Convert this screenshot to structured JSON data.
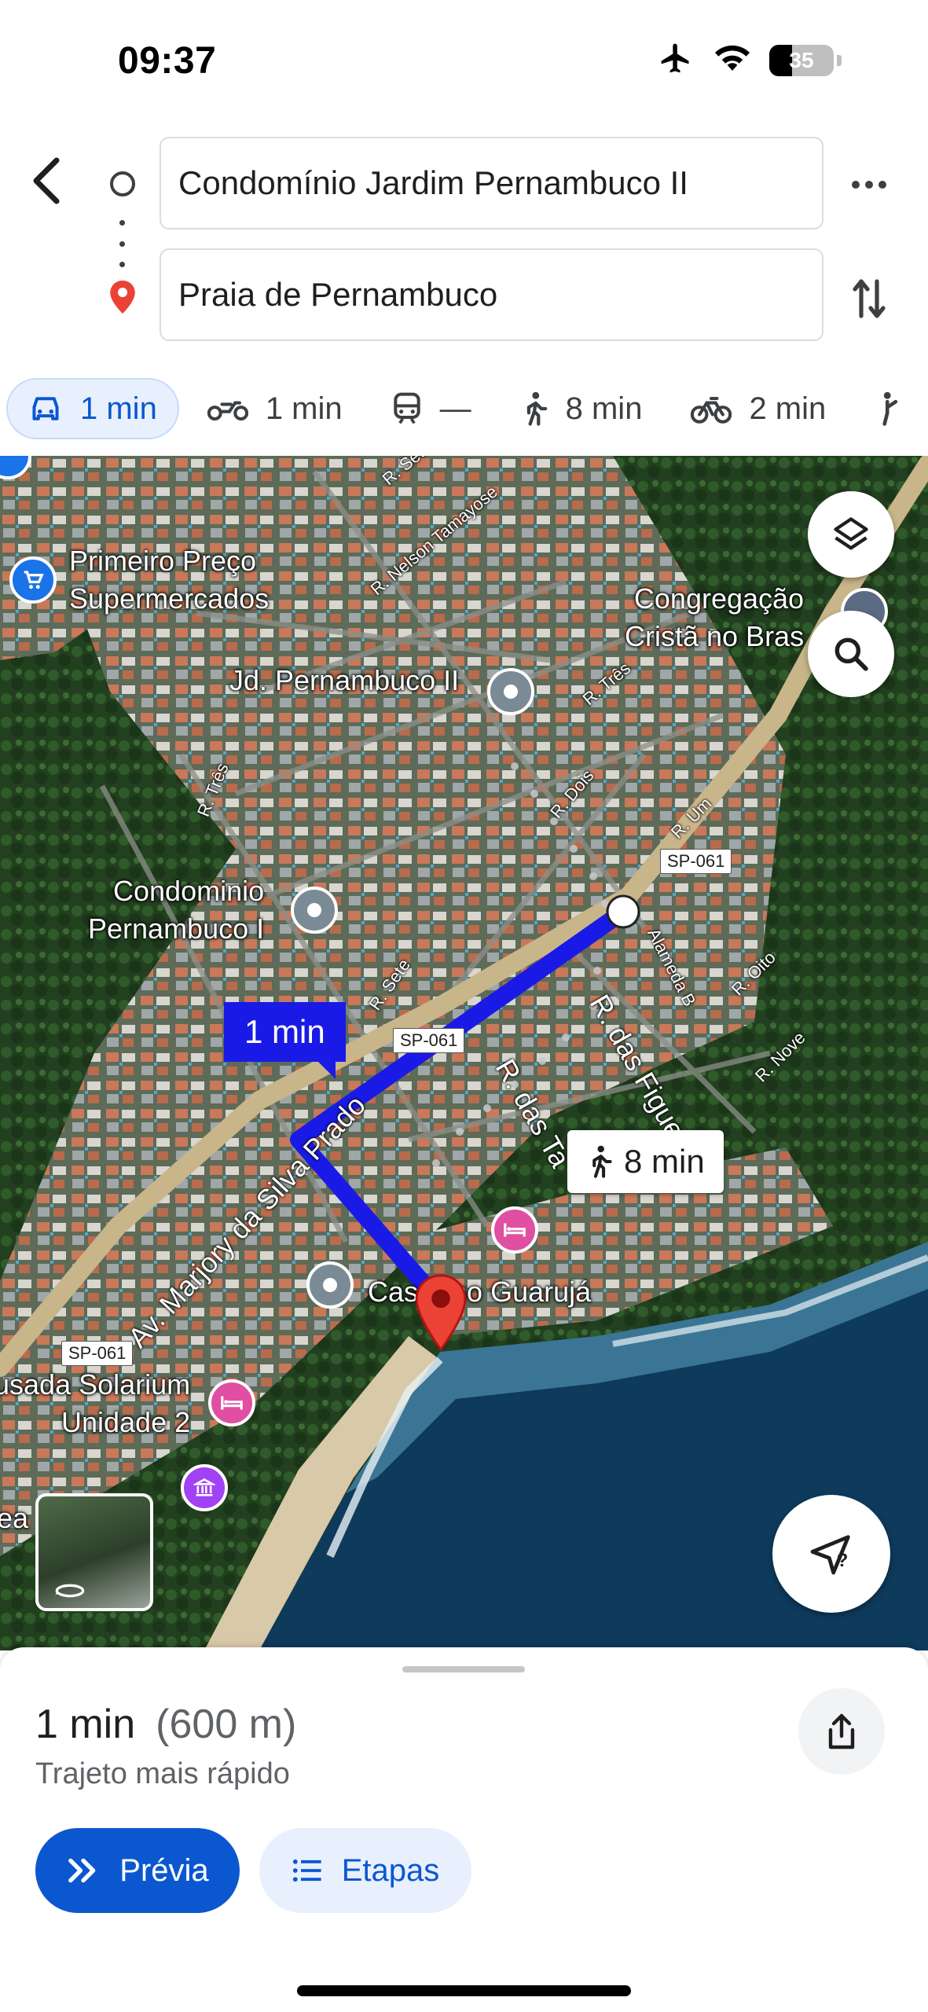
{
  "status_bar": {
    "time": "09:37",
    "battery": "35",
    "battery_level": 0.35
  },
  "route": {
    "origin": "Condomínio Jardim Pernambuco II",
    "destination": "Praia de Pernambuco"
  },
  "modes": [
    {
      "name": "car",
      "icon": "car-icon",
      "label": "1 min",
      "active": true
    },
    {
      "name": "motorcycle",
      "icon": "motorcycle-icon",
      "label": "1 min",
      "active": false
    },
    {
      "name": "transit",
      "icon": "train-icon",
      "label": "—",
      "active": false
    },
    {
      "name": "walk",
      "icon": "walk-icon",
      "label": "8 min",
      "active": false
    },
    {
      "name": "bike",
      "icon": "bike-icon",
      "label": "2 min",
      "active": false
    }
  ],
  "map": {
    "labels": {
      "primeiro_preco": "Primeiro Preço\nSupermercados",
      "congregacao": "Congregação\nCristã no Bras",
      "jd_pernambuco": "Jd. Pernambuco II",
      "condominio_pernambuco": "Condominio\nPernambuco I",
      "casar": "Casar no Guarujá",
      "pousada": "usada Solarium\nUnidade 2",
      "edge": "ea"
    },
    "streets": {
      "nelson": "R. Nelson Tamayose",
      "sete_top": "R. Sete",
      "tres_top": "R. Três",
      "tres_left": "R. Três",
      "dois": "R. Dois",
      "um": "R. Um",
      "alameda": "Alameda B",
      "oito": "R. Oito",
      "nove": "R. Nove",
      "sete": "R. Sete",
      "figueiras": "R. das Figue",
      "taman": "R. das Ta",
      "avenida": "Av. Marjory da Silva Prado"
    },
    "road_badges": {
      "sp1": "SP-061",
      "sp2": "SP-061",
      "sp3": "SP-061"
    },
    "drive_callout": "1 min",
    "walk_callout": "8 min",
    "colors": {
      "route": "#1a1ae6",
      "destination_pin": "#ea4335",
      "water": "#0e3a5c"
    }
  },
  "sheet": {
    "duration": "1 min",
    "distance": "(600 m)",
    "description": "Trajeto mais rápido",
    "preview_label": "Prévia",
    "steps_label": "Etapas"
  }
}
